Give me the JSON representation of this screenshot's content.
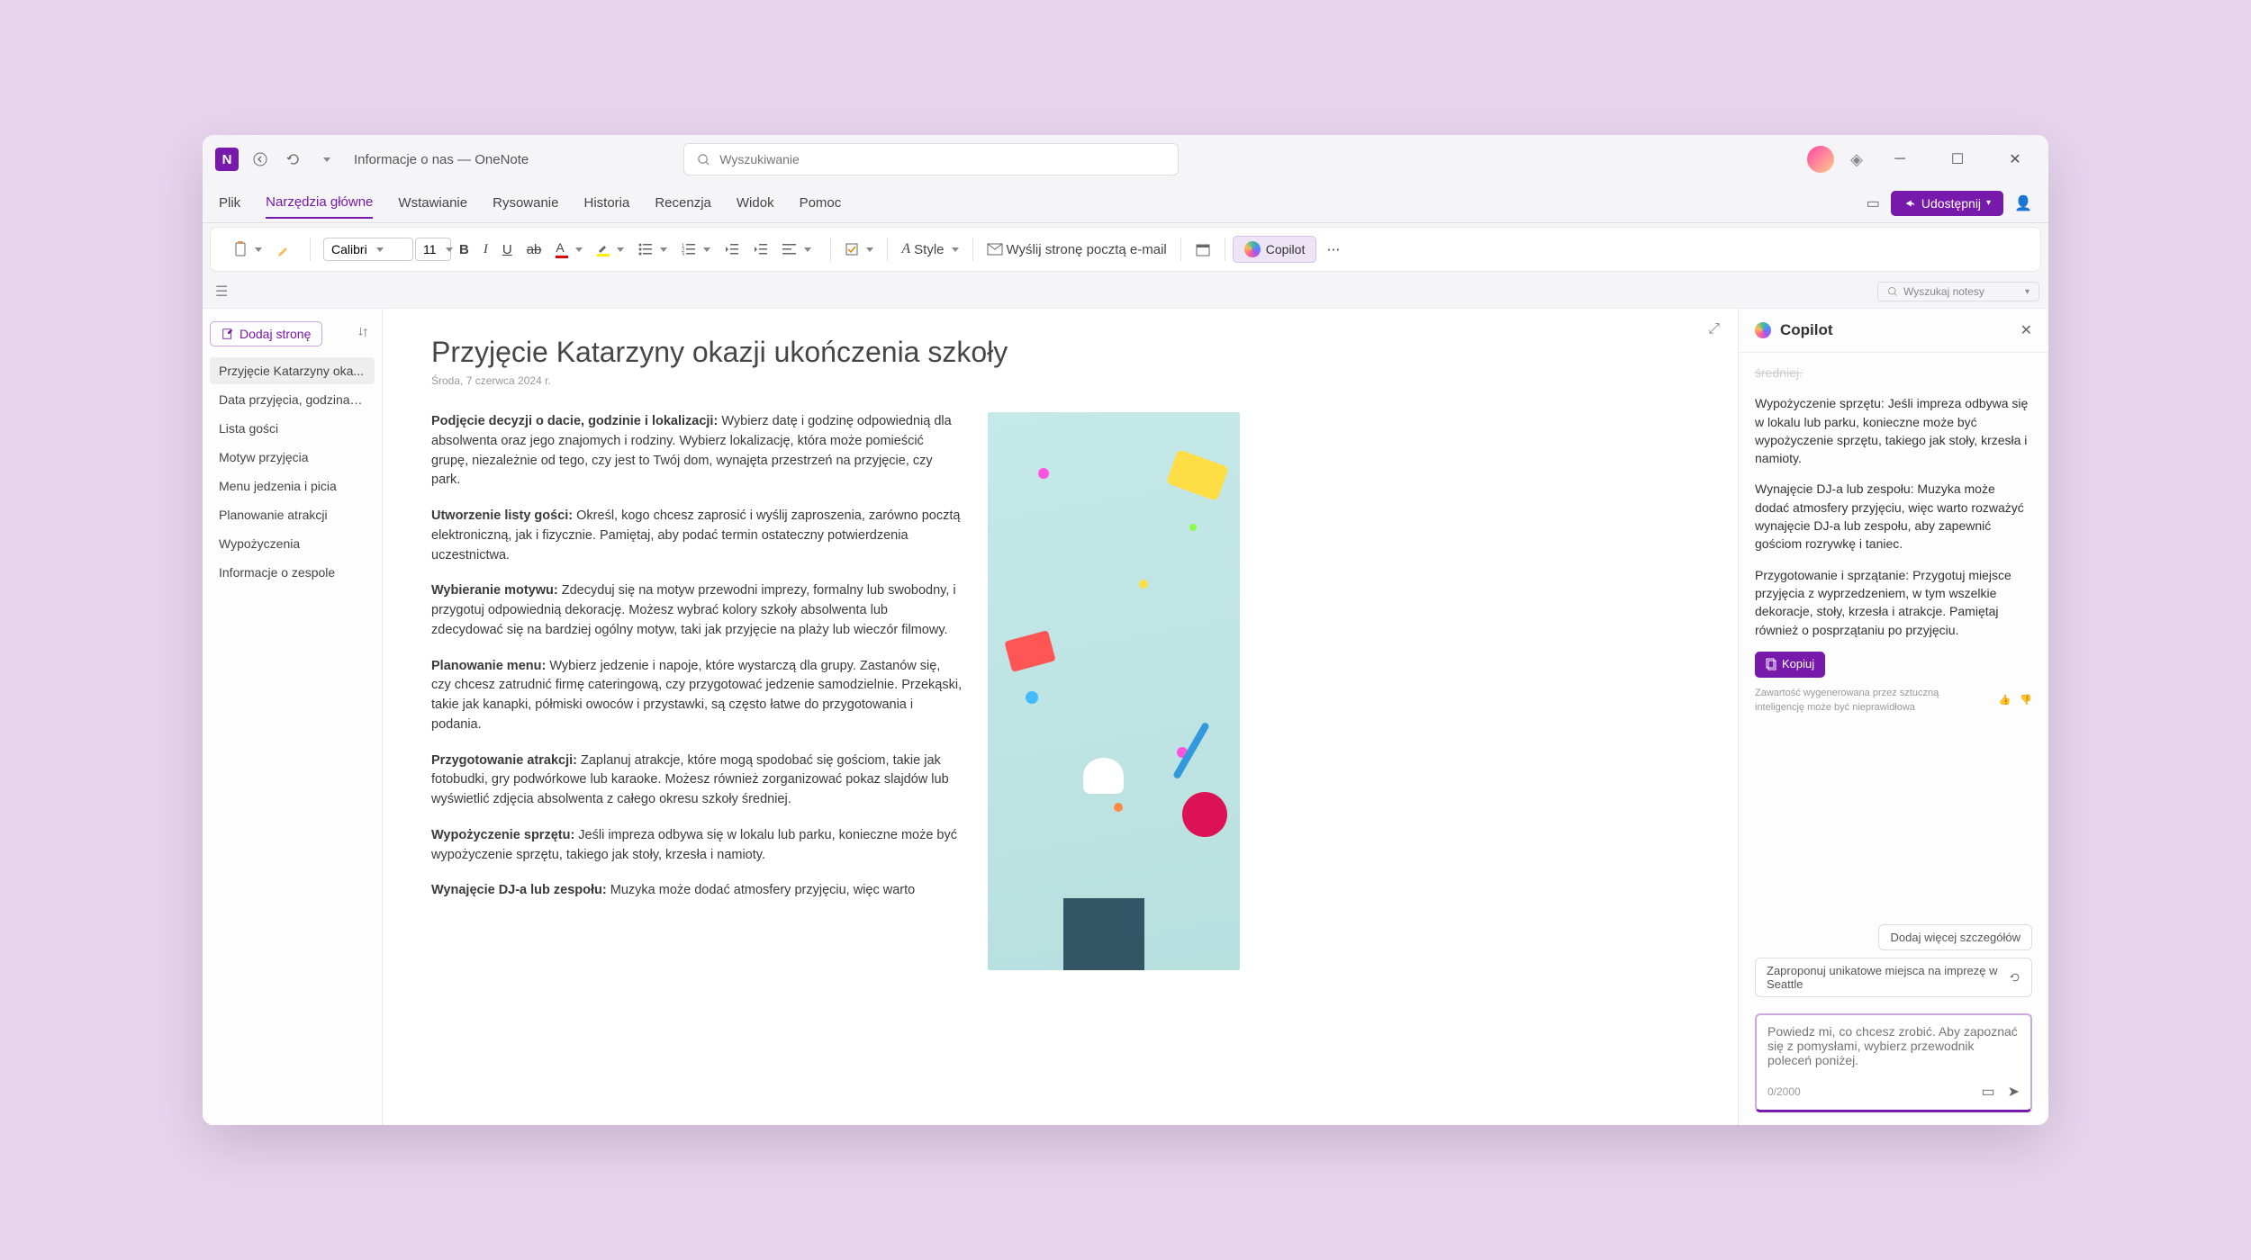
{
  "titlebar": {
    "app": "N",
    "title": "Informacje o nas — OneNote",
    "search_placeholder": "Wyszukiwanie"
  },
  "menu": {
    "items": [
      "Plik",
      "Narzędzia główne",
      "Wstawianie",
      "Rysowanie",
      "Historia",
      "Recenzja",
      "Widok",
      "Pomoc"
    ],
    "active_index": 1,
    "share": "Udostępnij"
  },
  "toolbar": {
    "font": "Calibri",
    "size": "11",
    "style": "Style",
    "email": "Wyślij stronę pocztą e-mail",
    "copilot": "Copilot"
  },
  "notebar": {
    "search": "Wyszukaj notesy"
  },
  "nav": {
    "add_page": "Dodaj stronę",
    "pages": [
      "Przyjęcie Katarzyny oka...",
      "Data przyjęcia, godzina i...",
      "Lista gości",
      "Motyw przyjęcia",
      "Menu jedzenia i picia",
      "Planowanie atrakcji",
      "Wypożyczenia",
      "Informacje o zespole"
    ],
    "selected": 0
  },
  "page": {
    "title": "Przyjęcie Katarzyny okazji ukończenia szkoły",
    "date": "Środa, 7 czerwca 2024 r.",
    "sections": [
      {
        "h": "Podjęcie decyzji o dacie, godzinie i lokalizacji:",
        "t": "Wybierz datę i godzinę odpowiednią dla absolwenta oraz jego znajomych i rodziny. Wybierz lokalizację, która może pomieścić grupę, niezależnie od tego, czy jest to Twój dom, wynajęta przestrzeń na przyjęcie, czy park."
      },
      {
        "h": "Utworzenie listy gości:",
        "t": "Określ, kogo chcesz zaprosić i wyślij zaproszenia, zarówno pocztą elektroniczną, jak i fizycznie. Pamiętaj, aby podać termin ostateczny potwierdzenia uczestnictwa."
      },
      {
        "h": "Wybieranie motywu:",
        "t": "Zdecyduj się na motyw przewodni imprezy, formalny lub swobodny, i przygotuj odpowiednią dekorację. Możesz wybrać kolory szkoły absolwenta lub zdecydować się na bardziej ogólny motyw, taki jak przyjęcie na plaży lub wieczór filmowy."
      },
      {
        "h": "Planowanie menu:",
        "t": "Wybierz jedzenie i napoje, które wystarczą dla grupy. Zastanów się, czy chcesz zatrudnić firmę cateringową, czy przygotować jedzenie samodzielnie. Przekąski, takie jak kanapki, półmiski owoców i przystawki, są często łatwe do przygotowania i podania."
      },
      {
        "h": "Przygotowanie atrakcji:",
        "t": "Zaplanuj atrakcje, które mogą spodobać się gościom, takie jak fotobudki, gry podwórkowe lub karaoke. Możesz również zorganizować pokaz slajdów lub wyświetlić zdjęcia absolwenta z całego okresu szkoły średniej."
      },
      {
        "h": "Wypożyczenie sprzętu:",
        "t": "Jeśli impreza odbywa się w lokalu lub parku, konieczne może być wypożyczenie sprzętu, takiego jak stoły, krzesła i namioty."
      },
      {
        "h": "Wynajęcie DJ-a lub zespołu:",
        "t": "Muzyka może dodać atmosfery przyjęciu, więc warto"
      }
    ]
  },
  "copilot": {
    "title": "Copilot",
    "msgs": [
      "średniej.",
      "Wypożyczenie sprzętu: Jeśli impreza odbywa się w lokalu lub parku, konieczne może być wypożyczenie sprzętu, takiego jak stoły, krzesła i namioty.",
      "Wynajęcie DJ-a lub zespołu: Muzyka może dodać atmosfery przyjęciu, więc warto rozważyć wynajęcie DJ-a lub zespołu, aby zapewnić gościom rozrywkę i taniec.",
      "Przygotowanie i sprzątanie: Przygotuj miejsce przyjęcia z wyprzedzeniem, w tym wszelkie dekoracje, stoły, krzesła i atrakcje. Pamiętaj również o posprzątaniu po przyjęciu."
    ],
    "copy": "Kopiuj",
    "disclaimer": "Zawartość wygenerowana przez sztuczną inteligencję może być nieprawidłowa",
    "suggestions": [
      "Dodaj więcej szczegółów",
      "Zaproponuj unikatowe miejsca na imprezę w Seattle"
    ],
    "placeholder": "Powiedz mi, co chcesz zrobić. Aby zapoznać się z pomysłami, wybierz przewodnik poleceń poniżej.",
    "counter": "0/2000"
  }
}
